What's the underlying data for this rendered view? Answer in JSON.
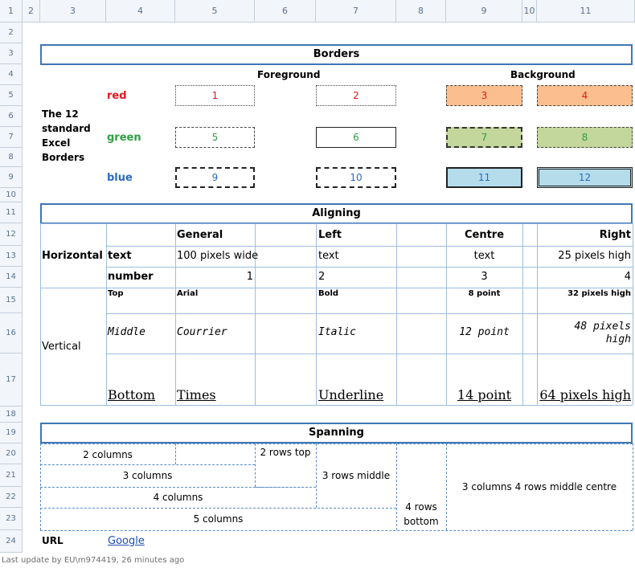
{
  "column_headers": [
    "1",
    "2",
    "3",
    "4",
    "5",
    "6",
    "7",
    "8",
    "9",
    "10",
    "11"
  ],
  "row_headers": [
    "1",
    "2",
    "3",
    "4",
    "5",
    "6",
    "7",
    "8",
    "9",
    "10",
    "11",
    "12",
    "13",
    "14",
    "15",
    "16",
    "17",
    "18",
    "19",
    "20",
    "21",
    "22",
    "23",
    "24"
  ],
  "borders": {
    "title": "Borders",
    "foreground": "Foreground",
    "background": "Background",
    "side_label": [
      "The 12",
      "standard",
      "Excel",
      "Borders"
    ],
    "rows": [
      {
        "label": "red",
        "color": "#e0161e",
        "cells": [
          "1",
          "2",
          "3",
          "4"
        ]
      },
      {
        "label": "green",
        "color": "#2ea043",
        "cells": [
          "5",
          "6",
          "7",
          "8"
        ]
      },
      {
        "label": "blue",
        "color": "#2a6cc0",
        "cells": [
          "9",
          "10",
          "11",
          "12"
        ]
      }
    ],
    "colors": {
      "orange": "#fbbf8f",
      "green": "#c3d69b",
      "blue": "#b4dcea",
      "red_text": "#e0161e",
      "green_text": "#2ea043",
      "blue_text": "#2a6cc0"
    }
  },
  "aligning": {
    "title": "Aligning",
    "col_general": "General",
    "col_left": "Left",
    "col_centre": "Centre",
    "col_right": "Right",
    "horizontal": "Horizontal",
    "text_label": "text",
    "number_label": "number",
    "text_general": "100 pixels wide",
    "text_left": "text",
    "text_centre": "text",
    "text_right": "25 pixels high",
    "num_general": "1",
    "num_left": "2",
    "num_centre": "3",
    "num_right": "4",
    "vertical": "Vertical",
    "top": [
      "Top",
      "Arial",
      "Bold",
      "8 point",
      "32 pixels high"
    ],
    "middle": [
      "Middle",
      "Courrier",
      "Italic",
      "12 point",
      "48 pixels",
      "high"
    ],
    "bottom": [
      "Bottom",
      "Times",
      "Underline",
      "14 point",
      "64 pixels high"
    ]
  },
  "spanning": {
    "title": "Spanning",
    "c2": "2 columns",
    "c3": "3 columns",
    "c4": "4 columns",
    "c5": "5 columns",
    "rows_top": "2 rows top",
    "rows_middle": "3 rows middle",
    "rows_bottom": [
      "4 rows",
      "bottom"
    ],
    "big": "3 columns 4 rows middle centre"
  },
  "url": {
    "label": "URL",
    "link": "Google"
  },
  "footer": "Last update by EU\\m974419, 26 minutes ago"
}
